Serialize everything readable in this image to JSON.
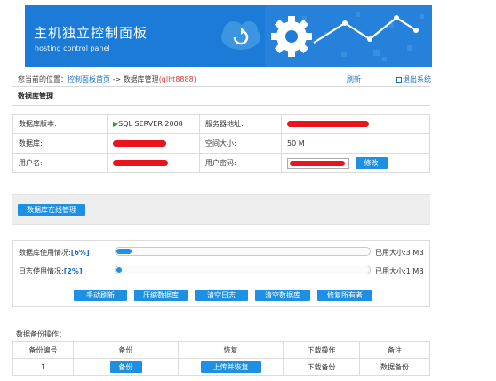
{
  "header": {
    "title": "主机独立控制面板",
    "subtitle": "hosting control panel"
  },
  "breadcrumb": {
    "prefix": "您当前的位置：",
    "home": "控制面板首页",
    "sep": " -> ",
    "current": "数据库管理",
    "account": "(glht8888)"
  },
  "top_links": {
    "refresh": "刷新",
    "logout": "退出系统"
  },
  "section_title": "数据库管理",
  "info": {
    "version_label": "数据库版本:",
    "version_value": "SQL SERVER 2008",
    "server_label": "服务器地址:",
    "db_label": "数据库:",
    "space_label": "空间大小:",
    "space_value": "50 M",
    "user_label": "用户名:",
    "pwd_label": "用户密码:",
    "edit_button": "修改"
  },
  "online_manage_button": "数据库在线管理",
  "usage": {
    "db_label": "数据库使用情况:",
    "db_pct": "[6%]",
    "db_fraction": 0.06,
    "db_size": "已用大小:3 MB",
    "log_label": "日志使用情况:",
    "log_pct": "[2%]",
    "log_fraction": 0.02,
    "log_size": "已用大小:1 MB"
  },
  "actions": {
    "refresh": "手动刷新",
    "compress": "压缩数据库",
    "clear_log": "清空日志",
    "clear_db": "清空数据库",
    "repair_owner": "修复所有者"
  },
  "backup": {
    "title": "数据备份操作：",
    "headers": [
      "备份编号",
      "备份",
      "恢复",
      "下载操作",
      "备注"
    ],
    "row": {
      "id": "1",
      "backup_btn": "备份",
      "restore_btn": "上传并恢复",
      "download": "下载备份",
      "note": "数据备份"
    }
  },
  "colors": {
    "banner": "#1c7bd6",
    "button": "#1e90e3",
    "progress": "#2490e0",
    "redaction": "#e8141e"
  }
}
